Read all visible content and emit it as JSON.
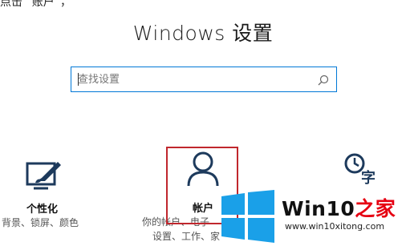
{
  "top_fragment": "点击 “账户”，",
  "page_title": "Windows 设置",
  "search": {
    "placeholder": "查找设置",
    "value": ""
  },
  "tiles": [
    {
      "key": "personalization",
      "title": "个性化",
      "desc": "背景、锁屏、颜色",
      "icon": "personalization-icon"
    },
    {
      "key": "accounts",
      "title": "帐户",
      "desc_line1": "你的帐户、电子",
      "desc_line2": "设置、工作、家",
      "icon": "user-account-icon",
      "highlighted": true
    },
    {
      "key": "time-language",
      "title": "",
      "desc": "",
      "icon": "time-language-icon"
    }
  ],
  "watermark": {
    "text_prefix": "Win10",
    "text_suffix": "之家",
    "url": "www.win10xitong.com",
    "icon": "windows-logo-icon"
  },
  "colors": {
    "accent": "#0078d7",
    "highlight_border": "#c0272d",
    "icon_dark": "#1d3a5c",
    "watermark_red": "#e60012"
  }
}
